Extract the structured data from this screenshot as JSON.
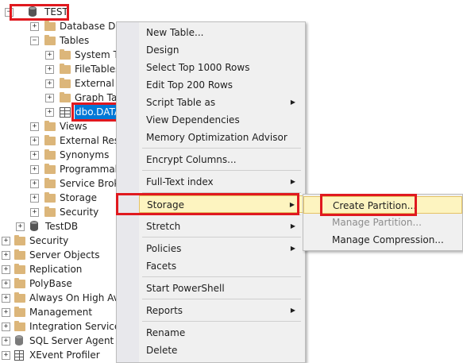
{
  "tree": {
    "root": "TEST",
    "items": [
      {
        "label": "Database Diag",
        "exp": "+"
      },
      {
        "label": "Tables",
        "exp": "−"
      },
      {
        "label": "System Ta",
        "exp": "+"
      },
      {
        "label": "FileTables",
        "exp": "+"
      },
      {
        "label": "External Ta",
        "exp": "+"
      },
      {
        "label": "Graph Tab",
        "exp": "+"
      },
      {
        "label": "dbo.DATA",
        "exp": "+"
      },
      {
        "label": "Views",
        "exp": "+"
      },
      {
        "label": "External Resou",
        "exp": "+"
      },
      {
        "label": "Synonyms",
        "exp": "+"
      },
      {
        "label": "Programmabi",
        "exp": "+"
      },
      {
        "label": "Service Broker",
        "exp": "+"
      },
      {
        "label": "Storage",
        "exp": "+"
      },
      {
        "label": "Security",
        "exp": "+"
      },
      {
        "label": "TestDB",
        "exp": "+"
      },
      {
        "label": "Security",
        "exp": "+"
      },
      {
        "label": "Server Objects",
        "exp": "+"
      },
      {
        "label": "Replication",
        "exp": "+"
      },
      {
        "label": "PolyBase",
        "exp": "+"
      },
      {
        "label": "Always On High Avai",
        "exp": "+"
      },
      {
        "label": "Management",
        "exp": "+"
      },
      {
        "label": "Integration Services C",
        "exp": "+"
      },
      {
        "label": "SQL Server Agent",
        "exp": "+"
      },
      {
        "label": "XEvent Profiler",
        "exp": "+"
      }
    ]
  },
  "context_menu": {
    "items": [
      "New Table...",
      "Design",
      "Select Top 1000 Rows",
      "Edit Top 200 Rows",
      "Script Table as",
      "View Dependencies",
      "Memory Optimization Advisor",
      "Encrypt Columns...",
      "Full-Text index",
      "Storage",
      "Stretch",
      "Policies",
      "Facets",
      "Start PowerShell",
      "Reports",
      "Rename",
      "Delete"
    ]
  },
  "submenu": {
    "items": [
      "Create Partition...",
      "Manage Partition...",
      "Manage Compression..."
    ]
  },
  "colors": {
    "highlight": "#e0191f",
    "selection": "#0078d7",
    "menu_hover": "#fdf4c0"
  }
}
